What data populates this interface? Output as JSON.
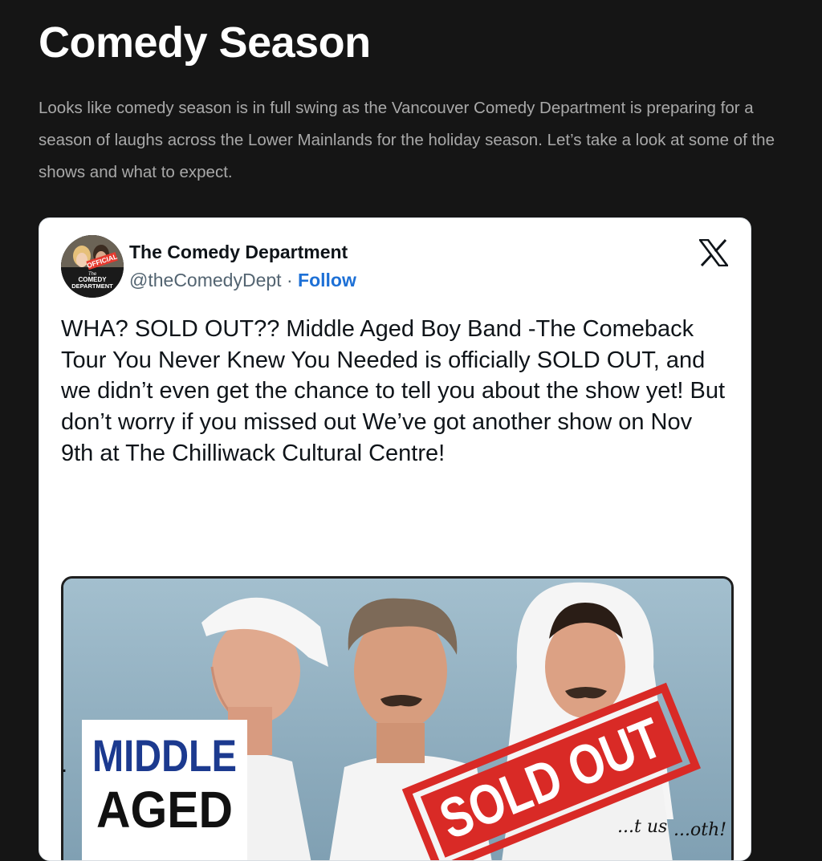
{
  "article": {
    "title": "Comedy Season",
    "intro": "Looks like comedy season is in full swing as the Vancouver Comedy Department is preparing for a season of laughs across the Lower Mainlands for the holiday season. Let’s take a look at some of the shows and what to expect."
  },
  "tweet": {
    "author_name": "The Comedy Department",
    "handle": "@theComedyDept",
    "separator": " · ",
    "follow_label": "Follow",
    "avatar_badge": "OFFICIAL",
    "avatar_the": "The",
    "avatar_line1": "COMEDY",
    "avatar_line2": "DEPARTMENT",
    "body": "WHA? SOLD OUT?? Middle Aged Boy Band -The Comeback Tour You Never Knew You Needed is officially SOLD OUT, and we didn’t even get the chance to tell you about the show yet! But don’t worry if you missed out We’ve got another show on Nov 9th at The Chilliwack Cultural Centre!",
    "trailing": ".",
    "logo_icon": "x-logo-icon"
  },
  "poster": {
    "title_line1": "MIDDLE",
    "title_line2": "AGED",
    "stamp": "SOLD OUT",
    "scrawl_left": "...t us",
    "scrawl_right": "...oth!"
  },
  "colors": {
    "page_bg": "#151515",
    "title": "#ffffff",
    "intro_text": "#a9a9a9",
    "card_bg": "#ffffff",
    "link": "#1d70d6",
    "poster_bg": "#94b2c2",
    "stamp_red": "#d92a26",
    "poster_title_blue": "#1c3a8f"
  }
}
